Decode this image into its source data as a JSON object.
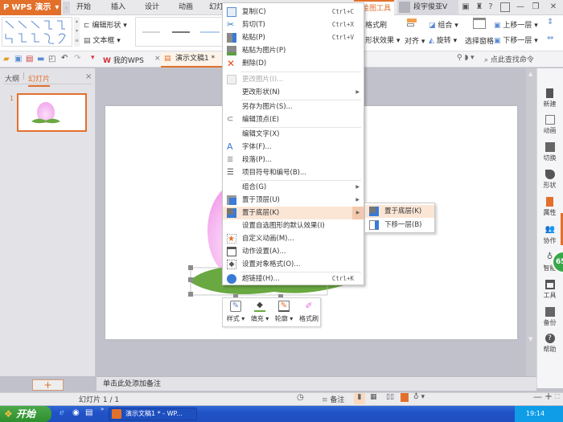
{
  "app": {
    "name": "WPS 演示",
    "brand_color": "#e2702b"
  },
  "tabs": [
    {
      "label": "开始"
    },
    {
      "label": "插入"
    },
    {
      "label": "设计"
    },
    {
      "label": "动画"
    },
    {
      "label": "幻灯"
    }
  ],
  "active_tool_tab": "绘图工具",
  "user": {
    "name": "段宇俊亚V"
  },
  "window_controls": {
    "minimize": "—",
    "restore": "❐",
    "close": "✕",
    "help": "?"
  },
  "ribbon": {
    "edit_shape": "编辑形状",
    "text_box": "文本框",
    "format_painter": "格式刷",
    "shape_effects": "形状效果",
    "align": "对齐",
    "group": "组合",
    "rotate": "旋转",
    "selection_pane": "选择窗格",
    "bring_forward": "上移一层",
    "send_backward": "下移一层"
  },
  "quick_access": {
    "my_wps": "我的WPS",
    "doc_tab": "演示文稿1 *",
    "search_placeholder": "点此查找命令"
  },
  "left_panel": {
    "tab_outline": "大纲",
    "tab_slides": "幻灯片",
    "slide_number": "1",
    "add_button": "+"
  },
  "context_menu": {
    "items": [
      {
        "label": "复制(C)",
        "shortcut": "Ctrl+C",
        "icon": "copy-icon"
      },
      {
        "label": "剪切(T)",
        "shortcut": "Ctrl+X",
        "icon": "cut-icon"
      },
      {
        "label": "粘贴(P)",
        "shortcut": "Ctrl+V",
        "icon": "paste-icon"
      },
      {
        "label": "粘贴为图片(P)",
        "icon": "paste-image-icon"
      },
      {
        "label": "删除(D)",
        "icon": "delete-icon"
      },
      {
        "label": "更改图片(I)...",
        "disabled": true,
        "icon": "change-image-icon"
      },
      {
        "label": "更改形状(N)",
        "submenu": true
      },
      {
        "label": "另存为图片(S)..."
      },
      {
        "label": "编辑顶点(E)",
        "icon": "edit-points-icon"
      },
      {
        "label": "编辑文字(X)"
      },
      {
        "label": "字体(F)...",
        "icon": "font-icon"
      },
      {
        "label": "段落(P)...",
        "icon": "paragraph-icon"
      },
      {
        "label": "项目符号和编号(B)...",
        "icon": "bullets-icon"
      },
      {
        "label": "组合(G)",
        "submenu": true
      },
      {
        "label": "置于顶层(U)",
        "submenu": true,
        "icon": "bring-to-front-icon"
      },
      {
        "label": "置于底层(K)",
        "submenu": true,
        "icon": "send-to-back-icon",
        "highlighted": true
      },
      {
        "label": "设置自选图形的默认效果(I)"
      },
      {
        "label": "自定义动画(M)...",
        "icon": "custom-animation-icon"
      },
      {
        "label": "动作设置(A)...",
        "icon": "action-settings-icon"
      },
      {
        "label": "设置对象格式(O)...",
        "icon": "format-object-icon"
      },
      {
        "label": "超链接(H)...",
        "shortcut": "Ctrl+K",
        "icon": "hyperlink-icon"
      }
    ]
  },
  "submenu": {
    "items": [
      {
        "label": "置于底层(K)",
        "highlighted": true
      },
      {
        "label": "下移一层(B)"
      }
    ]
  },
  "float_toolbar": {
    "style": "样式",
    "fill": "填充",
    "outline": "轮廓",
    "painter": "格式刷"
  },
  "right_sidebar": {
    "items": [
      "新建",
      "动画",
      "切换",
      "形状",
      "属性",
      "协作",
      "智能",
      "工具",
      "备份",
      "帮助"
    ],
    "badge": "65"
  },
  "notes_placeholder": "单击此处添加备注",
  "status": {
    "slide_info": "幻灯片 1 / 1",
    "notes_btn": "备注"
  },
  "taskbar": {
    "start": "开始",
    "task_item": "演示文稿1 * - WP...",
    "clock": "19:14"
  }
}
